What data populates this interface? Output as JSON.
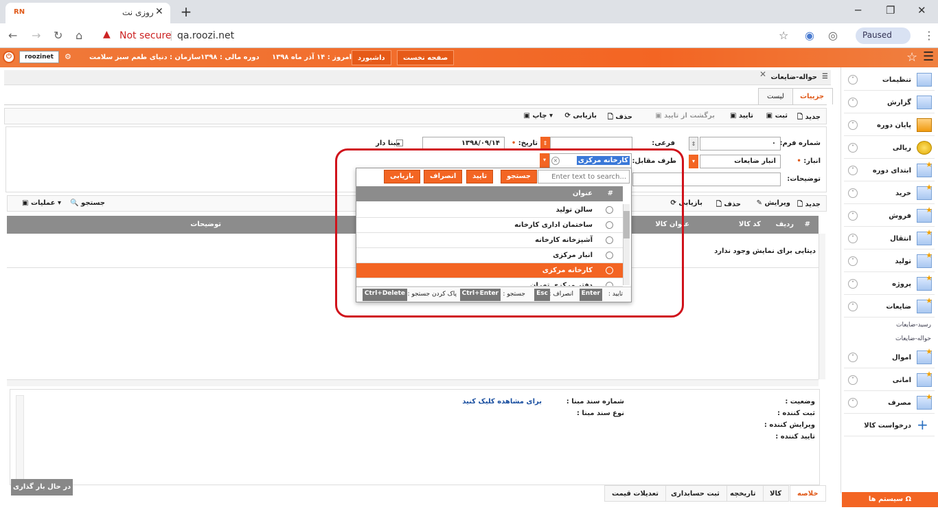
{
  "browser": {
    "tab_title": "روزی نت",
    "tab_favicon": "RN",
    "url": "qa.roozi.net",
    "security_label": "Not secure",
    "profile_status": "Paused"
  },
  "appbar": {
    "username": "roozinet",
    "org_label": "سازمان : دنیای طعم سبز سلامت",
    "fiscal_label": "دوره مالی : ۱۳۹۸",
    "today_label": "امروز : ۱۴ آذر ماه ۱۳۹۸",
    "dashboard_btn": "داشبورد",
    "first_page_btn": "صفحه نخست"
  },
  "sidebar": {
    "items": [
      {
        "label": "تنظیمات",
        "icon": "settings-folder-icon"
      },
      {
        "label": "گزارش",
        "icon": "report-clipboard-icon"
      },
      {
        "label": "پایان دوره",
        "icon": "period-end-icon"
      },
      {
        "label": "ریالی",
        "icon": "coins-icon"
      },
      {
        "label": "ابتدای دوره",
        "icon": "table-star-icon"
      },
      {
        "label": "خرید",
        "icon": "table-star-icon"
      },
      {
        "label": "فروش",
        "icon": "table-star-icon"
      },
      {
        "label": "انتقال",
        "icon": "table-star-icon"
      },
      {
        "label": "تولید",
        "icon": "table-star-icon"
      },
      {
        "label": "پروژه",
        "icon": "table-star-icon"
      },
      {
        "label": "ضایعات",
        "icon": "table-star-icon"
      },
      {
        "label": "اموال",
        "icon": "table-star-icon"
      },
      {
        "label": "امانی",
        "icon": "table-star-icon"
      },
      {
        "label": "مصرف",
        "icon": "table-star-icon"
      },
      {
        "label": "درخواست کالا",
        "icon": "plus-icon"
      }
    ],
    "sub_items": [
      "رسید-ضایعات",
      "حواله-ضایعات"
    ],
    "system_btn": "سیستم ها"
  },
  "main": {
    "title": "حواله-ضایعات",
    "tabs": [
      "جزییات",
      "لیست"
    ],
    "toolbar": [
      "جدید",
      "ثبت",
      "تایید",
      "برگشت از تایید",
      "حذف",
      "بازیابی",
      "چاپ"
    ],
    "form": {
      "form_no_label": "شماره فرم:",
      "form_no_value": "۰",
      "sub_label": "فرعی:",
      "date_label": "تاریخ:",
      "date_value": "۱۳۹۸/۰۹/۱۴",
      "based_label": "مبنا دار",
      "warehouse_label": "انبار:",
      "warehouse_value": "انبار ضایعات",
      "counterparty_label": "طرف مقابل:",
      "counterparty_value": "کارخانه مرکزی",
      "desc_label": "توضیحات:"
    },
    "grid_toolbar": [
      "جدید",
      "ویرایش",
      "حذف",
      "بازیابی",
      "جستجو",
      "عملیات"
    ],
    "grid_headers": [
      "#",
      "ردیف",
      "کد کالا",
      "عنوان کالا",
      "توضیحات"
    ],
    "grid_empty": "دیتایی برای نمایش وجود ندارد"
  },
  "footer": {
    "status_label": "وضعیت :",
    "creator_label": "ثبت کننده :",
    "editor_label": "ویرایش کننده :",
    "approver_label": "تایید کننده :",
    "doc_no_label": "شماره سند مبنا :",
    "doc_type_label": "نوع سند مبنا :",
    "view_link": "برای مشاهده کلیک کنید",
    "tabs": [
      "خلاصه",
      "کالا",
      "تاریخچه",
      "ثبت حسابداری",
      "تعدیلات قیمت"
    ],
    "loading": "در حال بار گذاری ..."
  },
  "popup": {
    "search_placeholder": "Enter text to search...",
    "buttons": [
      "جستجو",
      "تایید",
      "انصراف",
      "بازیابی"
    ],
    "header_hash": "#",
    "header_title": "عنوان",
    "rows": [
      "سالن تولید",
      "ساختمان اداری کارخانه",
      "آشپزخانه کارخانه",
      "انبار مرکزی",
      "کارخانه مرکزی",
      "دفتر مرکزی تهران"
    ],
    "selected_index": 4,
    "help": {
      "confirm": "تایید :",
      "confirm_key": "Enter",
      "cancel": "انصراف :",
      "cancel_key": "Esc",
      "search": "جستجو :",
      "search_key": "Ctrl+Enter",
      "clear": "پاک کردن جستجو :",
      "clear_key": "Ctrl+Delete"
    }
  }
}
